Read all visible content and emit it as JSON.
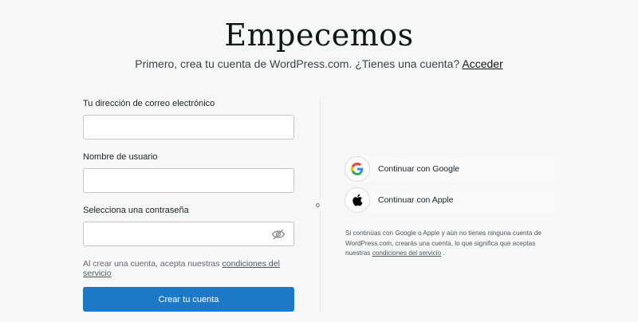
{
  "header": {
    "title": "Empecemos",
    "subtitle": "Primero, crea tu cuenta de WordPress.com. ¿Tienes una cuenta?",
    "login_link": "Acceder"
  },
  "form": {
    "email_label": "Tu dirección de correo electrónico",
    "email_value": "",
    "username_label": "Nombre de usuario",
    "username_value": "",
    "password_label": "Selecciona una contraseña",
    "password_value": "",
    "terms_text": "Al crear una cuenta, acepta nuestras",
    "terms_link": "condiciones del servicio",
    "terms_dot": ".",
    "submit_label": "Crear tu cuenta"
  },
  "divider": {
    "or_label": "o"
  },
  "social": {
    "google_label": "Continuar con Google",
    "apple_label": "Continuar con Apple",
    "disclaimer_text": "Si continúas con Google o Apple y aún no tienes ninguna cuenta de WordPress.com, crearás una cuenta, lo que significa que aceptas nuestras",
    "disclaimer_link": "condiciones del servicio",
    "disclaimer_end": ".",
    "icons": [
      "google-icon",
      "apple-icon",
      "eye-off-icon"
    ]
  },
  "colors": {
    "primary": "#1c79c7",
    "background": "#f6f7f7"
  }
}
